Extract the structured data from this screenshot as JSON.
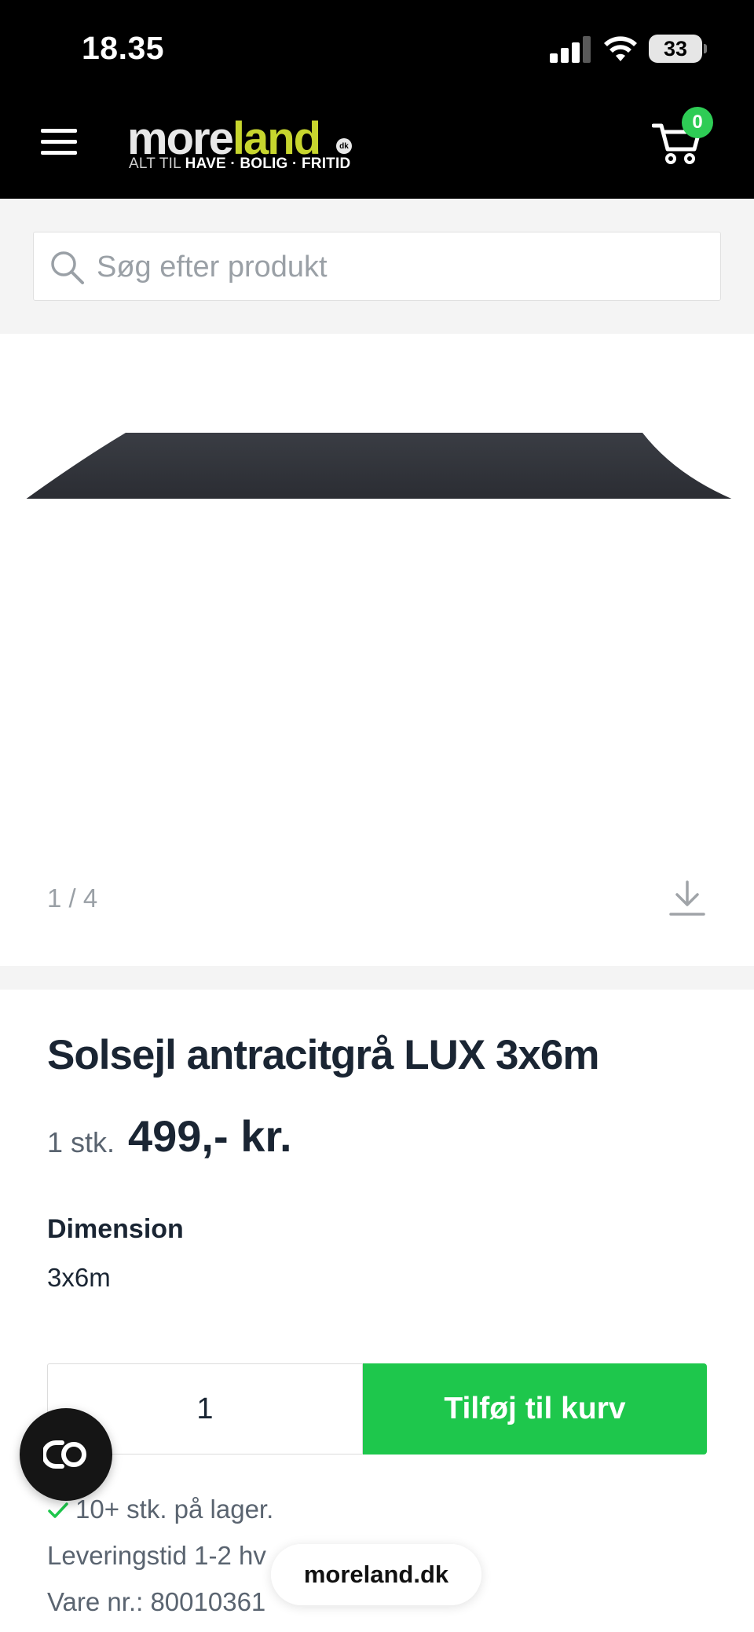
{
  "status_bar": {
    "time": "18.35",
    "battery": "33"
  },
  "header": {
    "logo_more": "more",
    "logo_land": "land",
    "logo_dk": "dk",
    "logo_tag_prefix": "ALT TIL ",
    "logo_tag_bold": "HAVE · BOLIG · FRITID",
    "cart_count": "0"
  },
  "search": {
    "placeholder": "Søg efter produkt"
  },
  "gallery": {
    "pager": "1 / 4"
  },
  "product": {
    "title": "Solsejl antracitgrå LUX 3x6m",
    "unit": "1 stk.",
    "price": "499,- kr.",
    "dimension_label": "Dimension",
    "dimension_value": "3x6m",
    "quantity": "1",
    "add_to_cart": "Tilføj til kurv",
    "stock": "10+ stk. på lager.",
    "delivery": "Leveringstid 1-2 hv",
    "sku": "Vare nr.: 80010361"
  },
  "browser": {
    "url": "moreland.dk"
  },
  "colors": {
    "accent_green": "#1ec74c",
    "logo_lime": "#c7d52e",
    "badge_green": "#2ecc55"
  }
}
